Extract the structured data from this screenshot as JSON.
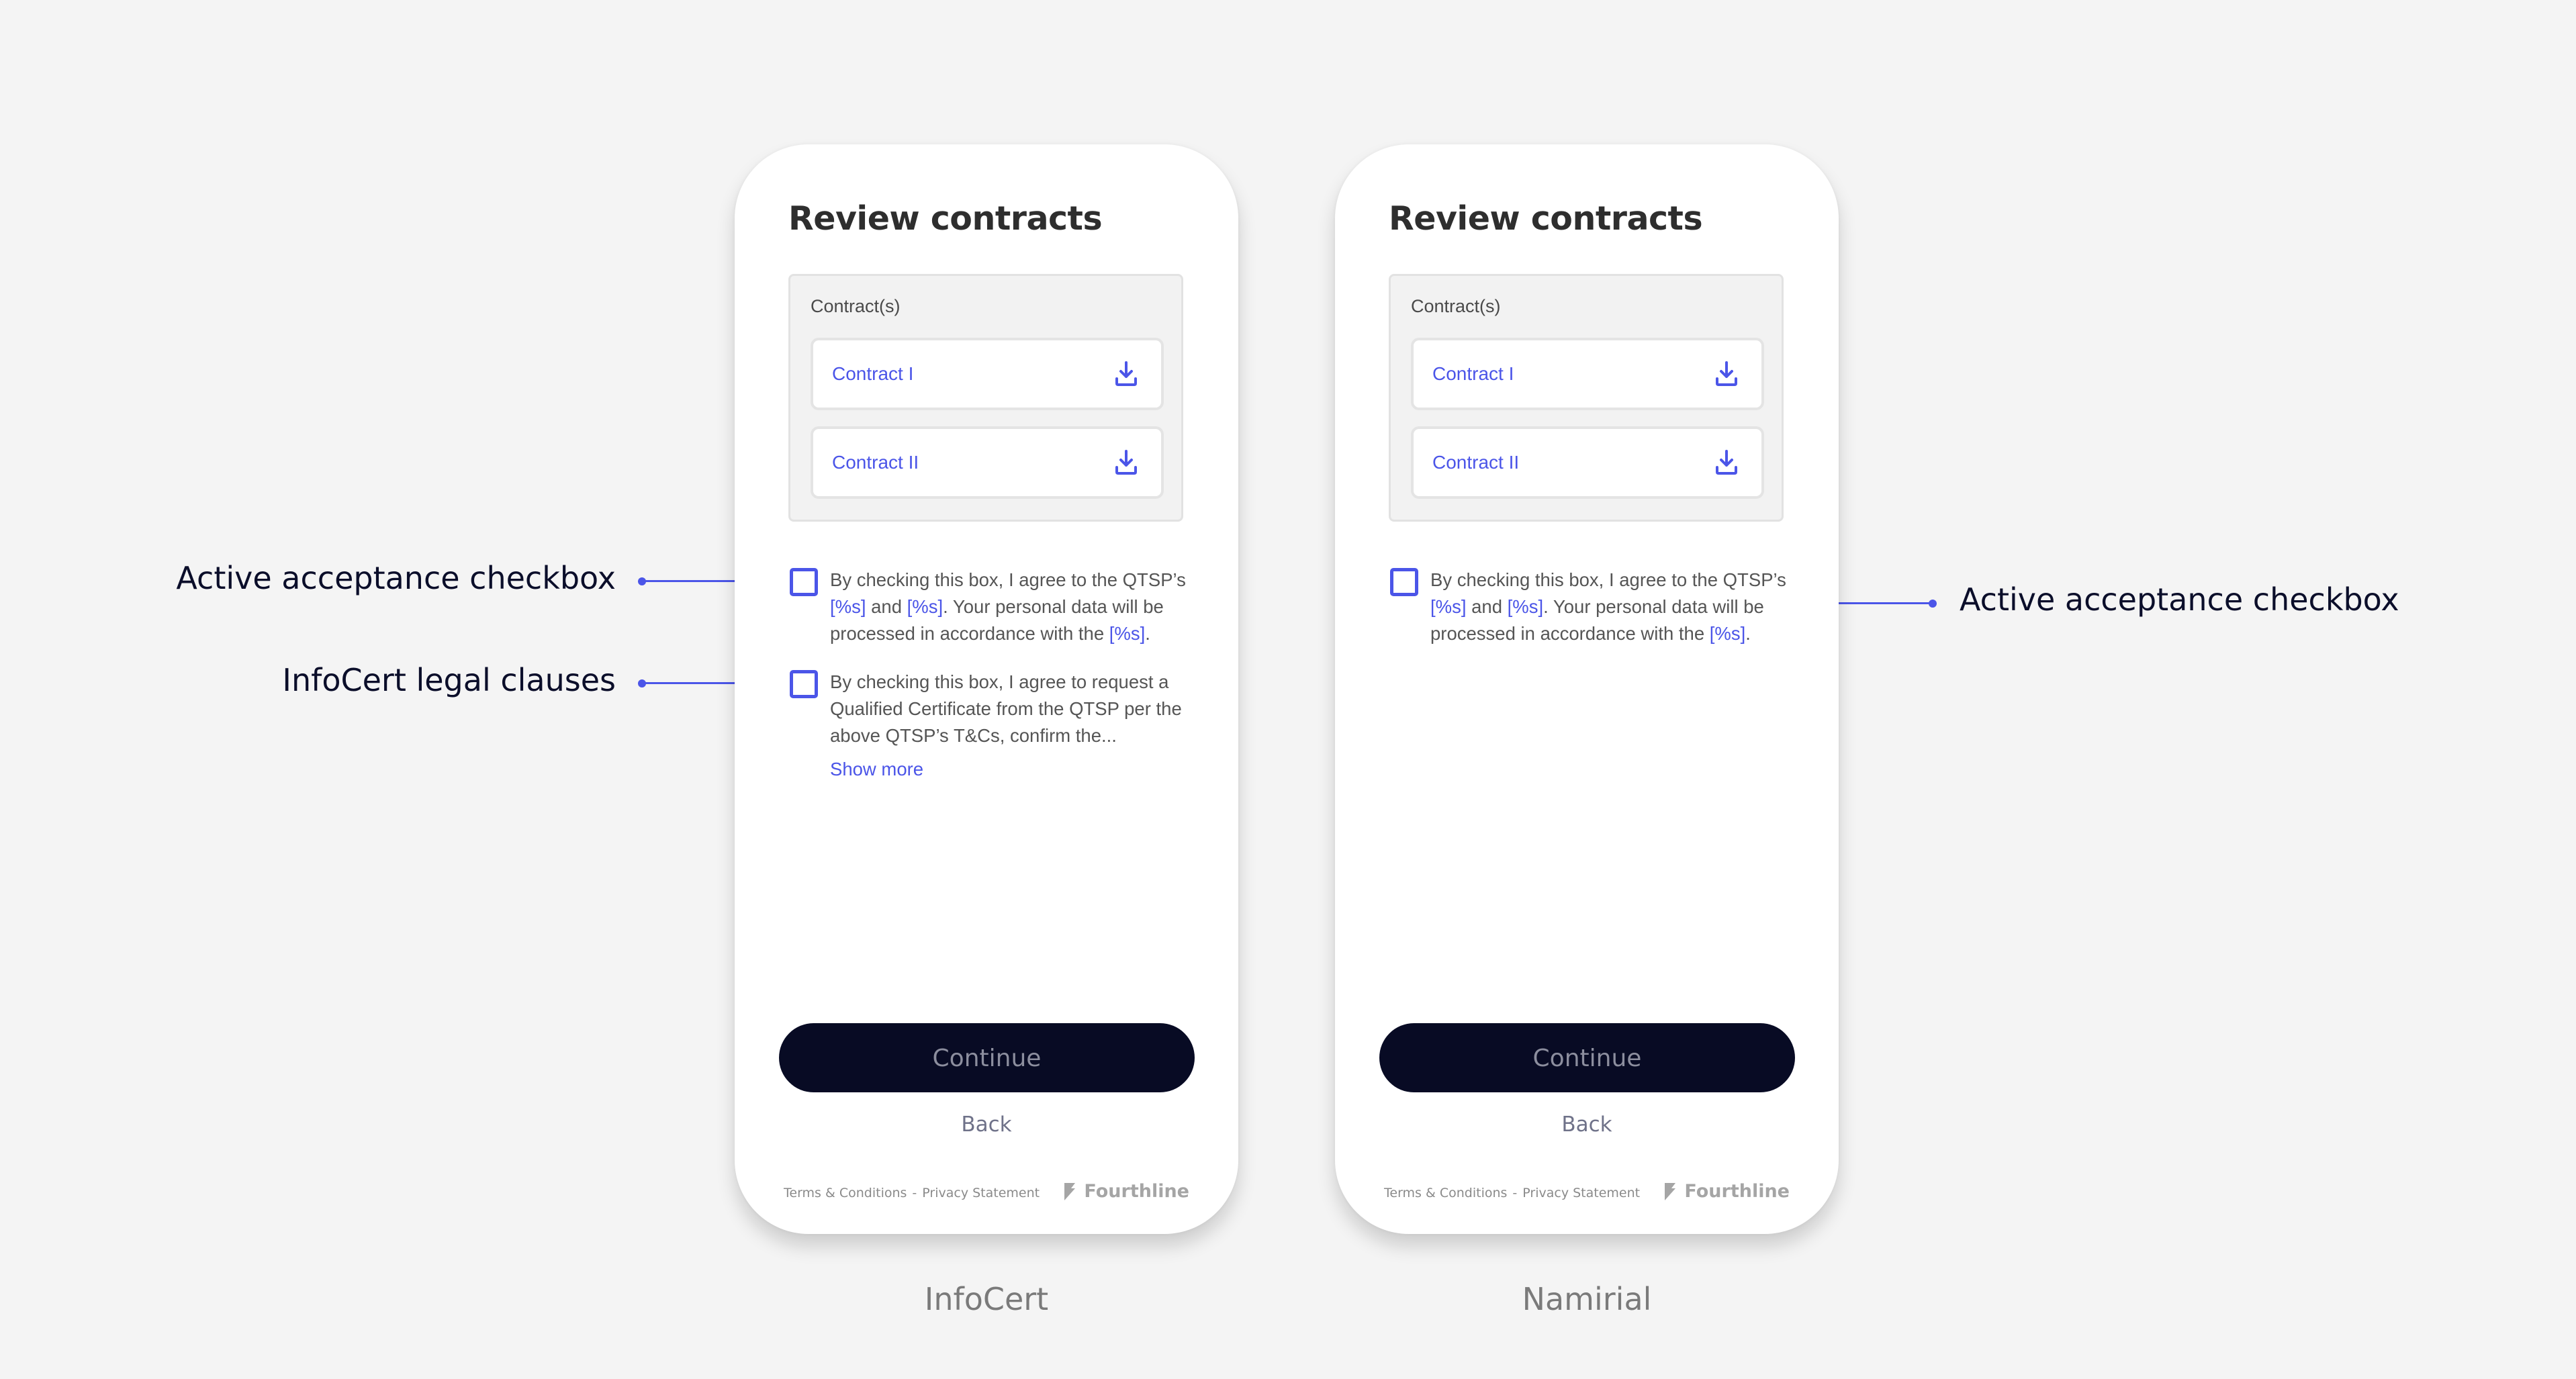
{
  "annotations": {
    "left_checkbox_label": "Active acceptance checkbox",
    "left_legal_label": "InfoCert legal clauses",
    "right_checkbox_label": "Active acceptance checkbox"
  },
  "colors": {
    "accent": "#4b55e8",
    "button_bg": "#080b24",
    "background": "#f4f4f4"
  },
  "screens": [
    {
      "caption": "InfoCert",
      "title": "Review contracts",
      "contracts_label": "Contract(s)",
      "contracts": [
        {
          "name": "Contract I",
          "icon": "download-icon"
        },
        {
          "name": "Contract II",
          "icon": "download-icon"
        }
      ],
      "acceptance": {
        "checked": false,
        "text_1": "By checking this box, I agree to the QTSP’s ",
        "ph_1": "[%s]",
        "text_2": " and ",
        "ph_2": "[%s]",
        "text_3": ". Your personal data will be processed in accordance with the ",
        "ph_3": "[%s]",
        "text_4": "."
      },
      "legal": {
        "checked": false,
        "text": "By checking this box, I agree to request a Qualified Certificate from the QTSP per the above QTSP’s T&Cs, confirm the...",
        "show_more": "Show more"
      },
      "continue_label": "Continue",
      "back_label": "Back",
      "footer": {
        "terms": "Terms & Conditions",
        "separator": "-",
        "privacy": "Privacy Statement",
        "brand": "Fourthline"
      }
    },
    {
      "caption": "Namirial",
      "title": "Review contracts",
      "contracts_label": "Contract(s)",
      "contracts": [
        {
          "name": "Contract I",
          "icon": "download-icon"
        },
        {
          "name": "Contract II",
          "icon": "download-icon"
        }
      ],
      "acceptance": {
        "checked": false,
        "text_1": "By checking this box, I agree to the QTSP’s ",
        "ph_1": "[%s]",
        "text_2": " and ",
        "ph_2": "[%s]",
        "text_3": ". Your personal data will be processed in accordance with the ",
        "ph_3": "[%s]",
        "text_4": "."
      },
      "continue_label": "Continue",
      "back_label": "Back",
      "footer": {
        "terms": "Terms & Conditions",
        "separator": "-",
        "privacy": "Privacy Statement",
        "brand": "Fourthline"
      }
    }
  ]
}
